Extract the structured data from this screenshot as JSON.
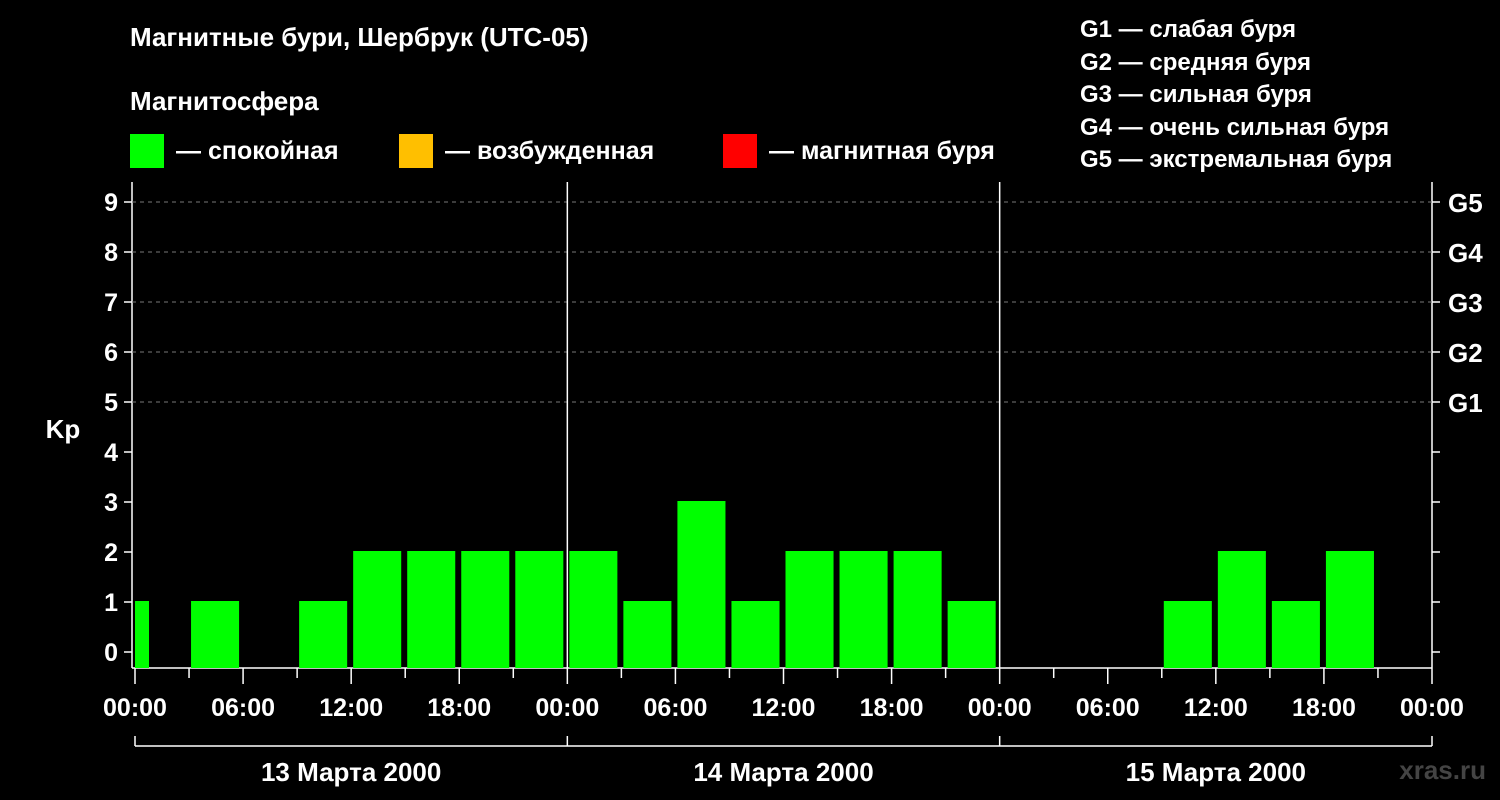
{
  "header": {
    "title": "Магнитные бури, Шербрук (UTC-05)",
    "subtitle": "Магнитосфера"
  },
  "legend": [
    {
      "color": "#00ff00",
      "label": "— спокойная"
    },
    {
      "color": "#ffbf00",
      "label": "— возбужденная"
    },
    {
      "color": "#ff0000",
      "label": "— магнитная буря"
    }
  ],
  "g_scale_legend": [
    "G1 — слабая буря",
    "G2 — средняя буря",
    "G3 — сильная буря",
    "G4 — очень сильная буря",
    "G5 — экстремальная буря"
  ],
  "watermark": "xras.ru",
  "chart_data": {
    "type": "bar",
    "ylabel": "Kp",
    "ylim": [
      0,
      9
    ],
    "y_ticks": [
      "0",
      "1",
      "2",
      "3",
      "4",
      "5",
      "6",
      "7",
      "8",
      "9"
    ],
    "right_ticks": [
      {
        "kp": 5,
        "label": "G1"
      },
      {
        "kp": 6,
        "label": "G2"
      },
      {
        "kp": 7,
        "label": "G3"
      },
      {
        "kp": 8,
        "label": "G4"
      },
      {
        "kp": 9,
        "label": "G5"
      }
    ],
    "x_tick_labels": [
      "00:00",
      "06:00",
      "12:00",
      "18:00",
      "00:00",
      "06:00",
      "12:00",
      "18:00",
      "00:00",
      "06:00",
      "12:00",
      "18:00",
      "00:00"
    ],
    "days": [
      "13 Марта 2000",
      "14 Марта 2000",
      "15 Марта 2000"
    ],
    "grid": "dashed horizontal at Kp 5–9",
    "bar_interval_hours": 3,
    "series": [
      {
        "values": [
          1,
          1,
          null,
          1,
          2,
          2,
          2,
          2,
          2,
          1,
          3,
          1,
          2,
          2,
          2,
          1,
          null,
          null,
          null,
          1,
          2,
          1,
          2,
          null
        ],
        "colors": [
          "#00ff00",
          "#00ff00",
          null,
          "#00ff00",
          "#00ff00",
          "#00ff00",
          "#00ff00",
          "#00ff00",
          "#00ff00",
          "#00ff00",
          "#00ff00",
          "#00ff00",
          "#00ff00",
          "#00ff00",
          "#00ff00",
          "#00ff00",
          null,
          null,
          null,
          "#00ff00",
          "#00ff00",
          "#00ff00",
          "#00ff00",
          null
        ]
      }
    ]
  }
}
